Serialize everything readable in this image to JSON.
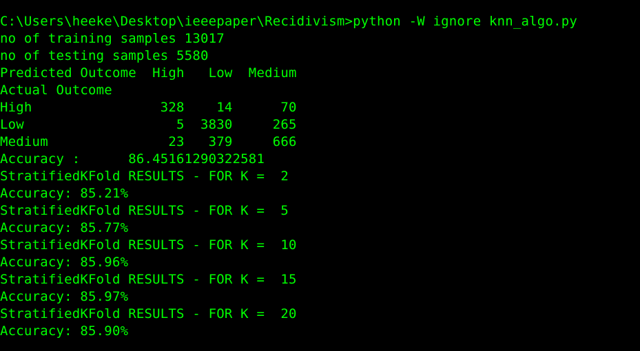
{
  "theme": {
    "background": "#000000",
    "text_color": "#00ff00"
  },
  "console": {
    "lines": [
      "C:\\Users\\heeke\\Desktop\\ieeepaper\\Recidivism>python -W ignore knn_algo.py",
      "no of training samples 13017",
      "no of testing samples 5580",
      "Predicted Outcome  High   Low  Medium",
      "Actual Outcome",
      "High                328    14      70",
      "Low                   5  3830     265",
      "Medium               23   379     666",
      "Accuracy :      86.45161290322581",
      "StratifiedKFold RESULTS - FOR K =  2",
      "Accuracy: 85.21%",
      "StratifiedKFold RESULTS - FOR K =  5",
      "Accuracy: 85.77%",
      "StratifiedKFold RESULTS - FOR K =  10",
      "Accuracy: 85.96%",
      "StratifiedKFold RESULTS - FOR K =  15",
      "Accuracy: 85.97%",
      "StratifiedKFold RESULTS - FOR K =  20",
      "Accuracy: 85.90%"
    ]
  }
}
